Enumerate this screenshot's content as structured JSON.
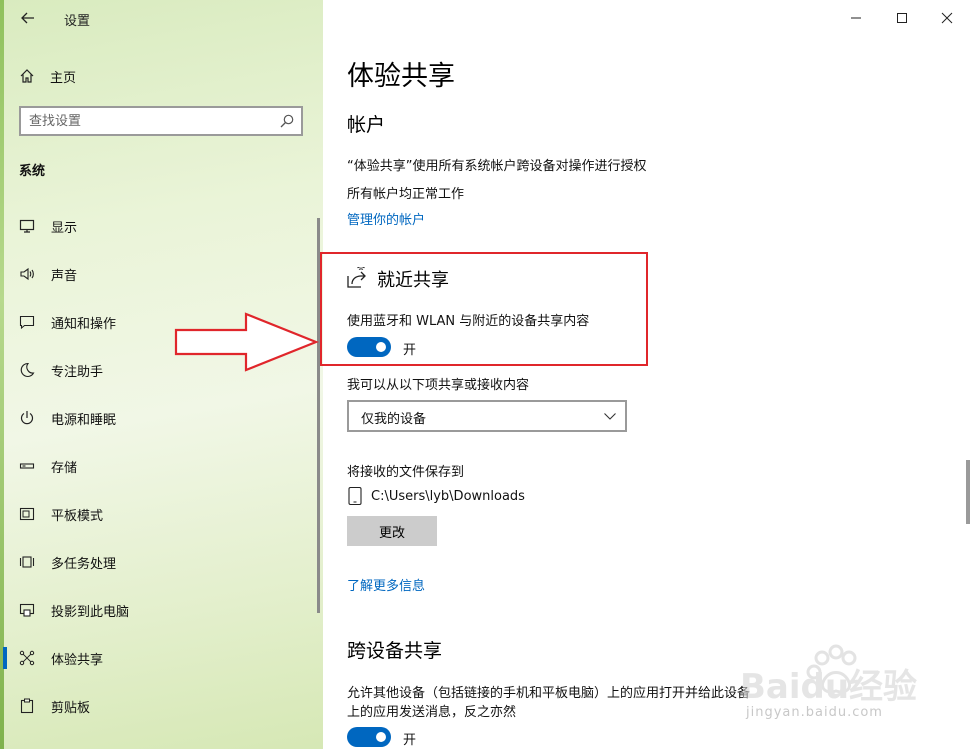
{
  "window": {
    "title": "设置",
    "back_icon": "back-arrow-icon",
    "controls": [
      "minimize-icon",
      "maximize-icon",
      "close-icon"
    ]
  },
  "sidebar": {
    "home_label": "主页",
    "search_placeholder": "查找设置",
    "section_title": "系统",
    "items": [
      {
        "label": "显示",
        "icon": "display-icon"
      },
      {
        "label": "声音",
        "icon": "speaker-icon"
      },
      {
        "label": "通知和操作",
        "icon": "notification-icon"
      },
      {
        "label": "专注助手",
        "icon": "moon-icon"
      },
      {
        "label": "电源和睡眠",
        "icon": "power-icon"
      },
      {
        "label": "存储",
        "icon": "storage-icon"
      },
      {
        "label": "平板模式",
        "icon": "tablet-mode-icon"
      },
      {
        "label": "多任务处理",
        "icon": "multitask-icon"
      },
      {
        "label": "投影到此电脑",
        "icon": "project-icon"
      },
      {
        "label": "体验共享",
        "icon": "shared-experiences-icon",
        "active": true
      },
      {
        "label": "剪贴板",
        "icon": "clipboard-icon"
      }
    ]
  },
  "main": {
    "page_title": "体验共享",
    "accounts": {
      "heading": "帐户",
      "line1": "“体验共享”使用所有系统帐户跨设备对操作进行授权",
      "line2": "所有帐户均正常工作",
      "manage_link": "管理你的帐户"
    },
    "nearby": {
      "heading": "就近共享",
      "description": "使用蓝牙和 WLAN 与附近的设备共享内容",
      "toggle_label": "开",
      "share_receive_label": "我可以从以下项共享或接收内容",
      "dropdown_value": "仅我的设备",
      "save_label": "将接收的文件保存到",
      "save_path": "C:\\Users\\lyb\\Downloads",
      "change_button": "更改",
      "learn_more_link": "了解更多信息"
    },
    "cross_device": {
      "heading": "跨设备共享",
      "description_line1": "允许其他设备（包括链接的手机和平板电脑）上的应用打开并给此设备",
      "description_line2": "上的应用发送消息，反之亦然",
      "toggle_label": "开"
    }
  },
  "watermark": {
    "brand": "Baidu经验",
    "url": "jingyan.baidu.com"
  },
  "colors": {
    "accent": "#0067c0",
    "annotation_red": "#e0262b"
  }
}
